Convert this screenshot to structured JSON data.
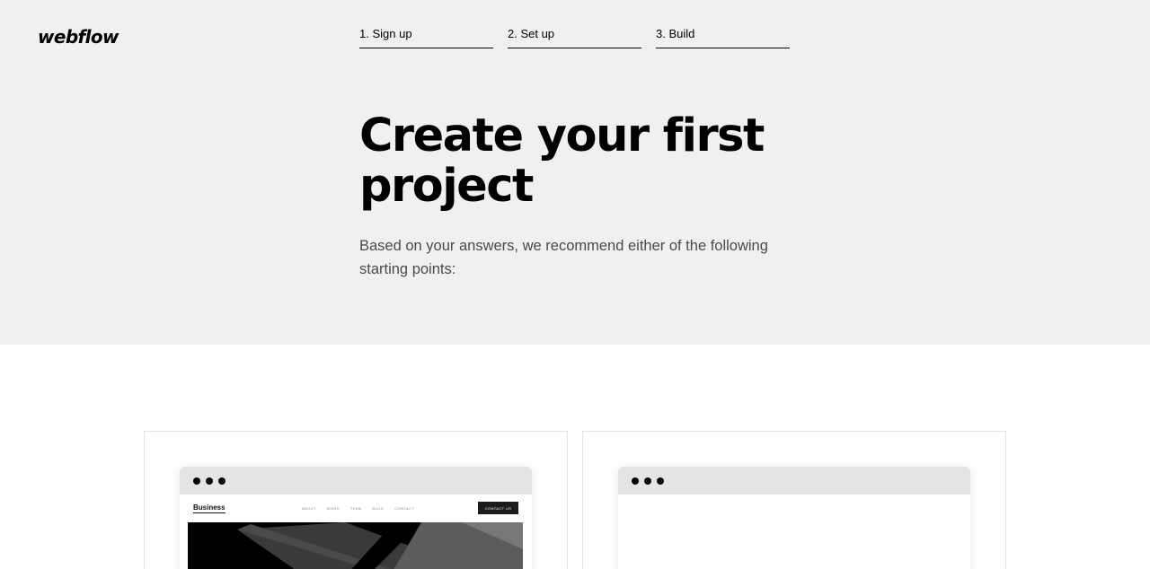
{
  "brand": {
    "logo": "webflow"
  },
  "steps": [
    {
      "label": "1. Sign up"
    },
    {
      "label": "2. Set up"
    },
    {
      "label": "3. Build"
    }
  ],
  "hero": {
    "title": "Create your first project",
    "subtitle": "Based on your answers, we recommend either of the following starting points:"
  },
  "templates": [
    {
      "site_name": "Business",
      "nav": [
        "ABOUT",
        "WORK",
        "TEAM",
        "BLOG",
        "CONTACT"
      ],
      "cta": "CONTACT US"
    },
    {}
  ],
  "colors": {
    "hero_bg": "#f0f0f0",
    "browser_bar": "#e4e4e4",
    "text_muted": "#4a4a4a"
  }
}
